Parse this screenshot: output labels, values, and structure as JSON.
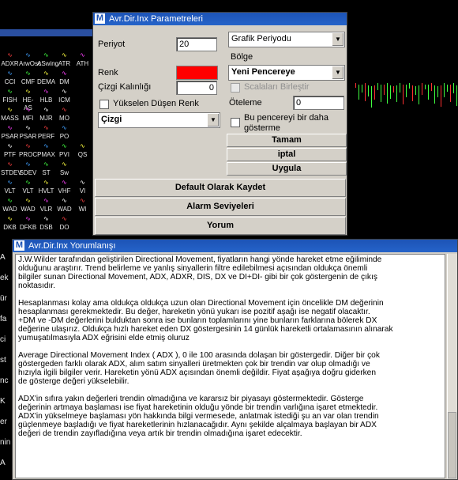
{
  "palette": {
    "rows": [
      [
        "ADXR",
        "ArwOsc",
        "ASwing",
        "ATR",
        "ATH"
      ],
      [
        "CCI",
        "CMF",
        "DEMA",
        "DM"
      ],
      [
        "FISH",
        "HE-AS",
        "HLB",
        "ICM"
      ],
      [
        "MASS",
        "MFI",
        "MJR",
        "MO"
      ],
      [
        "PSAR",
        "PSAR",
        "PERF",
        "PO"
      ],
      [
        "PTF",
        "PROC",
        "PMAX",
        "PVI",
        "QS"
      ],
      [
        "STDEV",
        "SDEV",
        "ST",
        "Sw"
      ],
      [
        "VLT",
        "VLT",
        "HVLT",
        "VHF",
        "VI"
      ],
      [
        "WAD",
        "WAD",
        "VLR",
        "WAD",
        "WI"
      ],
      [
        "DKB",
        "DFKB",
        "DSB",
        "DO"
      ]
    ]
  },
  "left_strip": [
    "A",
    "ek",
    "ür",
    "fa",
    "ci",
    "st",
    "nc",
    "K",
    "er",
    "nin",
    "A"
  ],
  "param_dialog": {
    "title": "Avr.Dir.Inx Parametreleri",
    "period_label": "Periyot",
    "period_value": "20",
    "color_label": "Renk",
    "color_value": "#ff0000",
    "line_width_label": "Çizgi Kalınlığı",
    "line_width_value": "0",
    "rise_fall_color_label": "Yükselen Düşen Renk",
    "line_style_value": "Çizgi",
    "graph_period_value": "Grafik Periyodu",
    "region_label": "Bölge",
    "region_value": "Yeni Pencereye",
    "merge_scales_label": "Scalaları Birleştir",
    "shift_label": "Öteleme",
    "shift_value": "0",
    "show_once_label_1": "Bu pencereyi bir daha",
    "show_once_label_2": "gösterme",
    "ok_label": "Tamam",
    "cancel_label": "iptal",
    "apply_label": "Uygula",
    "save_default_label": "Default Olarak Kaydet",
    "alarm_levels_label": "Alarm Seviyeleri",
    "comment_label": "Yorum"
  },
  "comment_window": {
    "title": "Avr.Dir.Inx Yorumlanışı",
    "paragraphs": [
      "J.W.Wilder tarafından geliştirilen Directional Movement, fiyatların hangi yönde hareket etme eğiliminde\nolduğunu araştırır. Trend belirleme ve yanlış sinyallerin filtre edilebilmesi açısından oldukça önemli\nbilgiler sunan Directional Movement, ADX, ADXR, DIS, DX ve DI+DI- gibi bir çok göstergenin de çıkış\nnoktasıdır.",
      "Hesaplanması kolay ama oldukça oldukça uzun olan Directional Movement için öncelikle DM değerinin\nhesaplanması gerekmektedir. Bu değer, hareketin yönü yukarı ise pozitif aşağı ise negatif olacaktır.\n+DM ve -DM değerlerini bulduktan sonra ise bunların toplamlarını yine bunların farklarına bölerek DX\ndeğerine ulaşırız. Oldukça hızlı hareket eden DX göstergesinin 14 günlük hareketli ortalamasının alınarak\nyumuşatılmasıyla ADX eğrisini elde etmiş oluruz",
      "Average Directional Movement Index ( ADX ), 0 ile 100 arasında dolaşan bir göstergedir. Diğer bir çok\ngöstergeden farklı olarak ADX, alım satım sinyalleri üretmekten çok bir trendin var olup olmadığı ve\nhızıyla ilgili bilgiler verir. Hareketin yönü ADX açısından önemli değildir. Fiyat aşağıya doğru giderken\nde gösterge değeri yükselebilir.",
      "ADX'in sıfıra yakın değerleri trendin olmadığına ve kararsız bir piyasayı göstermektedir. Gösterge\ndeğerinin artmaya başlaması ise fiyat hareketinin olduğu yönde bir trendin varlığına işaret etmektedir.\nADX'in yükselmeye başlaması yön hakkında bilgi vermesede, anlatmak istediği şu an var olan trendin\ngüçlenmeye başladığı ve fiyat hareketlerinin hızlanacağıdır. Aynı şekilde alçalmaya başlayan bir ADX\ndeğeri de trendin zayıfladığına veya artık bir trendin olmadığına işaret edecektir."
    ]
  }
}
